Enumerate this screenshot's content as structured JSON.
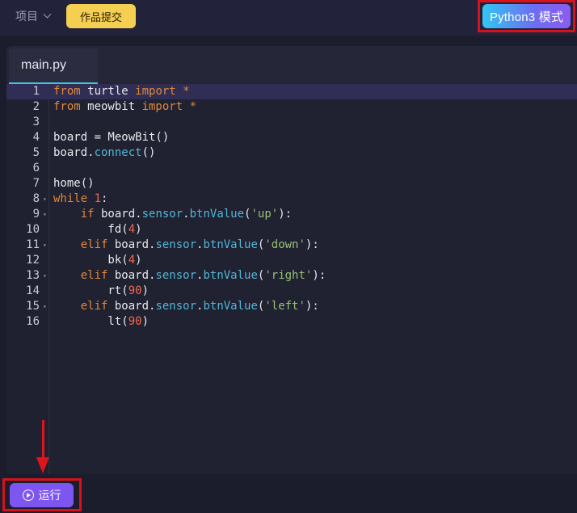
{
  "topbar": {
    "project_label": "项目",
    "submit_label": "作品提交",
    "mode_label": "Python3 模式"
  },
  "editor": {
    "tab_label": "main.py",
    "lines": [
      {
        "n": "1",
        "html": "<span class=\"kw\">from</span> turtle <span class=\"kw\">import</span> <span class=\"op\">*</span>"
      },
      {
        "n": "2",
        "html": "<span class=\"kw\">from</span> meowbit <span class=\"kw\">import</span> <span class=\"op\">*</span>"
      },
      {
        "n": "3",
        "html": ""
      },
      {
        "n": "4",
        "html": "board = MeowBit()"
      },
      {
        "n": "5",
        "html": "board.<span class=\"fn\">connect</span>()"
      },
      {
        "n": "6",
        "html": ""
      },
      {
        "n": "7",
        "html": "home()"
      },
      {
        "n": "8",
        "fold": true,
        "html": "<span class=\"kw\">while</span> <span class=\"num\">1</span>:"
      },
      {
        "n": "9",
        "fold": true,
        "html": "    <span class=\"kw\">if</span> board.<span class=\"fn\">sensor</span>.<span class=\"fn\">btnValue</span>(<span class=\"str\">'up'</span>):"
      },
      {
        "n": "10",
        "html": "        fd(<span class=\"num\">4</span>)"
      },
      {
        "n": "11",
        "fold": true,
        "html": "    <span class=\"kw\">elif</span> board.<span class=\"fn\">sensor</span>.<span class=\"fn\">btnValue</span>(<span class=\"str\">'down'</span>):"
      },
      {
        "n": "12",
        "html": "        bk(<span class=\"num\">4</span>)"
      },
      {
        "n": "13",
        "fold": true,
        "html": "    <span class=\"kw\">elif</span> board.<span class=\"fn\">sensor</span>.<span class=\"fn\">btnValue</span>(<span class=\"str\">'right'</span>):"
      },
      {
        "n": "14",
        "html": "        rt(<span class=\"num\">90</span>)"
      },
      {
        "n": "15",
        "fold": true,
        "html": "    <span class=\"kw\">elif</span> board.<span class=\"fn\">sensor</span>.<span class=\"fn\">btnValue</span>(<span class=\"str\">'left'</span>):"
      },
      {
        "n": "16",
        "html": "        lt(<span class=\"num\">90</span>)"
      }
    ]
  },
  "bottombar": {
    "run_label": "运行"
  },
  "colors": {
    "highlight_box": "#d8111a",
    "run_button": "#7d55f1",
    "submit_button": "#f5cf52"
  }
}
